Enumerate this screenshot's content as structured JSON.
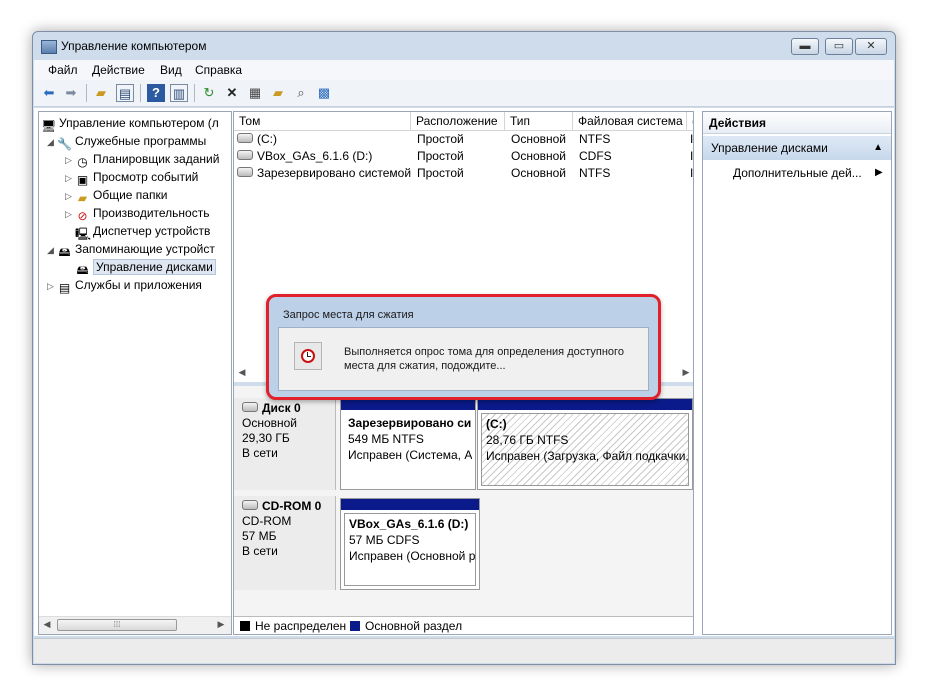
{
  "window": {
    "title": "Управление компьютером",
    "controls": {
      "minimize": "▬",
      "maximize": "▭",
      "close": "✕"
    }
  },
  "menu": [
    "Файл",
    "Действие",
    "Вид",
    "Справка"
  ],
  "toolbar": {
    "icons": [
      "back-arrow-icon",
      "forward-arrow-icon",
      "up-folder-icon",
      "show-hide-tree-icon",
      "help-icon",
      "help-panel-icon",
      "refresh-icon",
      "delete-icon",
      "properties-icon",
      "open-folder-icon",
      "search-icon",
      "export-icon"
    ]
  },
  "tree": {
    "items": [
      {
        "label": "Управление компьютером (л",
        "expander": "",
        "icon": "computer-management-icon"
      },
      {
        "label": "Служебные программы",
        "expander": "◢",
        "icon": "tools-icon"
      },
      {
        "label": "Планировщик заданий",
        "expander": "▷",
        "icon": "clock-icon"
      },
      {
        "label": "Просмотр событий",
        "expander": "▷",
        "icon": "event-viewer-icon"
      },
      {
        "label": "Общие папки",
        "expander": "▷",
        "icon": "shared-folder-icon"
      },
      {
        "label": "Производительность",
        "expander": "▷",
        "icon": "performance-icon"
      },
      {
        "label": "Диспетчер устройств",
        "expander": "",
        "icon": "device-manager-icon"
      },
      {
        "label": "Запоминающие устройст",
        "expander": "◢",
        "icon": "storage-icon"
      },
      {
        "label": "Управление дисками",
        "expander": "",
        "icon": "disk-management-icon"
      },
      {
        "label": "Службы и приложения",
        "expander": "▷",
        "icon": "services-icon"
      }
    ]
  },
  "volumes": {
    "columns": [
      "Том",
      "Расположение",
      "Тип",
      "Файловая система",
      "("
    ],
    "rows": [
      {
        "name": "(C:)",
        "location": "Простой",
        "type": "Основной",
        "fs": "NTFS",
        "extra": "І"
      },
      {
        "name": "VBox_GAs_6.1.6 (D:)",
        "location": "Простой",
        "type": "Основной",
        "fs": "CDFS",
        "extra": "І"
      },
      {
        "name": "Зарезервировано системой",
        "location": "Простой",
        "type": "Основной",
        "fs": "NTFS",
        "extra": "І"
      }
    ]
  },
  "disks": [
    {
      "name": "Диск 0",
      "kind": "Основной",
      "size": "29,30 ГБ",
      "status": "В сети",
      "partitions": [
        {
          "name": "Зарезервировано си",
          "size": "549 МБ NTFS",
          "status": "Исправен (Система, А"
        },
        {
          "name": "(C:)",
          "size": "28,76 ГБ NTFS",
          "status": "Исправен (Загрузка, Файл подкачки,"
        }
      ]
    },
    {
      "name": "CD-ROM 0",
      "kind": "CD-ROM",
      "size": "57 МБ",
      "status": "В сети",
      "partitions": [
        {
          "name": "VBox_GAs_6.1.6  (D:)",
          "size": "57 МБ CDFS",
          "status": "Исправен (Основной р"
        }
      ]
    }
  ],
  "legend": [
    {
      "label": "Не распределен",
      "color": "#000000"
    },
    {
      "label": "Основной раздел",
      "color": "#0a1a8a"
    }
  ],
  "actions": {
    "header": "Действия",
    "selected": "Управление дисками",
    "more": "Дополнительные дей..."
  },
  "dialog": {
    "title": "Запрос места для сжатия",
    "message_line1": "Выполняется опрос тома для определения доступного",
    "message_line2": "места для сжатия, подождите..."
  }
}
